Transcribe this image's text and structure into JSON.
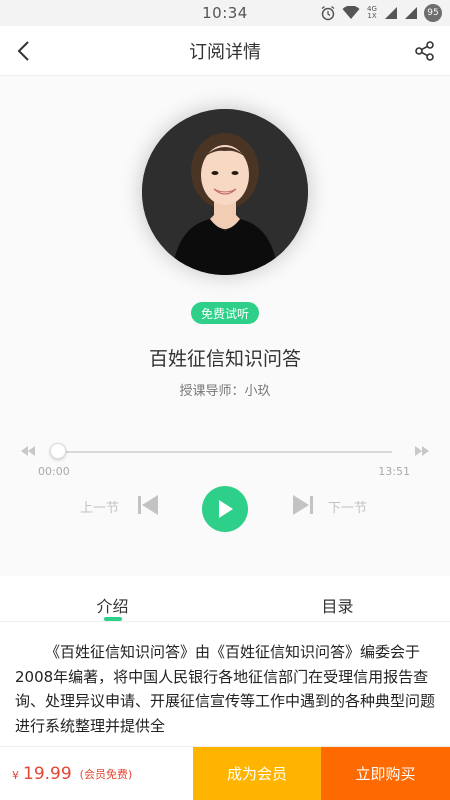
{
  "status_bar": {
    "time": "10:34",
    "network_top": "4G",
    "network_bottom": "1X",
    "battery": "95"
  },
  "nav": {
    "title": "订阅详情",
    "back_icon": "chevron-left-icon",
    "share_icon": "share-icon"
  },
  "course": {
    "badge": "免费试听",
    "title": "百姓征信知识问答",
    "instructor": "授课导师：小玖"
  },
  "player": {
    "current_time": "00:00",
    "total_time": "13:51",
    "progress": 0,
    "prev_label": "上一节",
    "next_label": "下一节"
  },
  "tabs": [
    {
      "label": "介绍",
      "active": true
    },
    {
      "label": "目录",
      "active": false
    }
  ],
  "description": "《百姓征信知识问答》由《百姓征信知识问答》编委会于2008年编著，将中国人民银行各地征信部门在受理信用报告查询、处理异议申请、开展征信宣传等工作中遇到的各种典型问题进行系统整理并提供全",
  "bottom_bar": {
    "currency": "¥",
    "price": "19.99",
    "member_note": "(会员免费)",
    "member_button": "成为会员",
    "buy_button": "立即购买"
  },
  "colors": {
    "accent_green": "#2ed089",
    "price_red": "#e5462f",
    "member_yellow": "#ffb400",
    "buy_orange": "#ff6a00"
  }
}
